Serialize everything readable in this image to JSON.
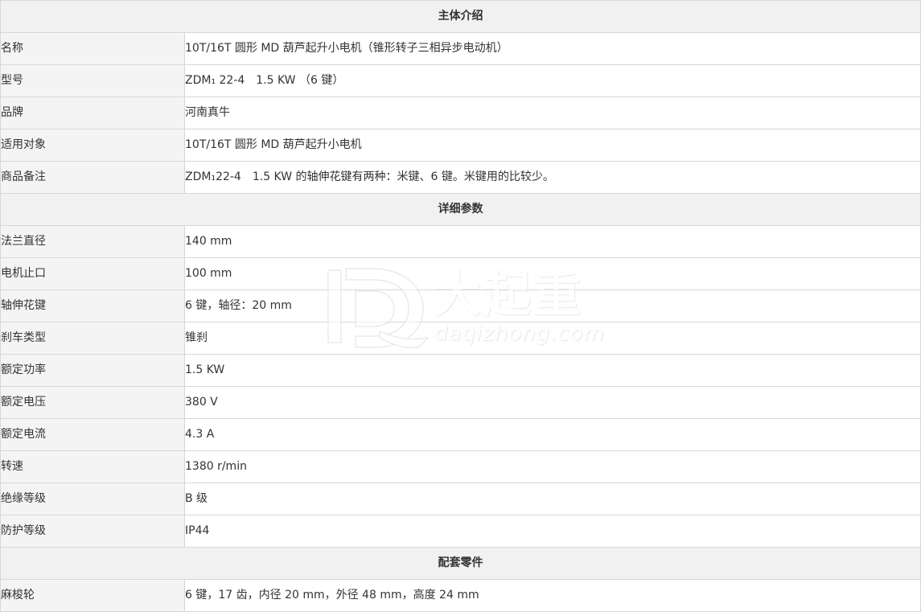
{
  "sections": [
    {
      "title": "主体介绍",
      "rows": [
        {
          "label": "名称",
          "value": "10T/16T 圆形 MD 葫芦起升小电机（锥形转子三相异步电动机）"
        },
        {
          "label": "型号",
          "value": "ZDM₁ 22-4　1.5 KW （6 键）"
        },
        {
          "label": "品牌",
          "value": "河南真牛"
        },
        {
          "label": "适用对象",
          "value": "10T/16T 圆形 MD 葫芦起升小电机"
        },
        {
          "label": "商品备注",
          "value": "ZDM₁22-4　1.5 KW 的轴伸花键有两种：米键、6 键。米键用的比较少。"
        }
      ]
    },
    {
      "title": "详细参数",
      "rows": [
        {
          "label": "法兰直径",
          "value": "140 mm"
        },
        {
          "label": "电机止口",
          "value": "100 mm"
        },
        {
          "label": "轴伸花键",
          "value": "6 键，轴径：20 mm"
        },
        {
          "label": "刹车类型",
          "value": "锥刹"
        },
        {
          "label": "额定功率",
          "value": "1.5 KW"
        },
        {
          "label": "额定电压",
          "value": "380 V"
        },
        {
          "label": "额定电流",
          "value": "4.3 A"
        },
        {
          "label": "转速",
          "value": "1380 r/min"
        },
        {
          "label": "绝缘等级",
          "value": "B 级"
        },
        {
          "label": "防护等级",
          "value": "IP44"
        }
      ]
    },
    {
      "title": "配套零件",
      "rows": [
        {
          "label": "麻梭轮",
          "value": "6 键，17 齿，内径 20 mm，外径 48 mm，高度 24 mm"
        }
      ]
    }
  ],
  "watermark": {
    "cn": "大起重",
    "en": "daqizhong.com",
    "icon": "daqizhong-logo-icon"
  }
}
